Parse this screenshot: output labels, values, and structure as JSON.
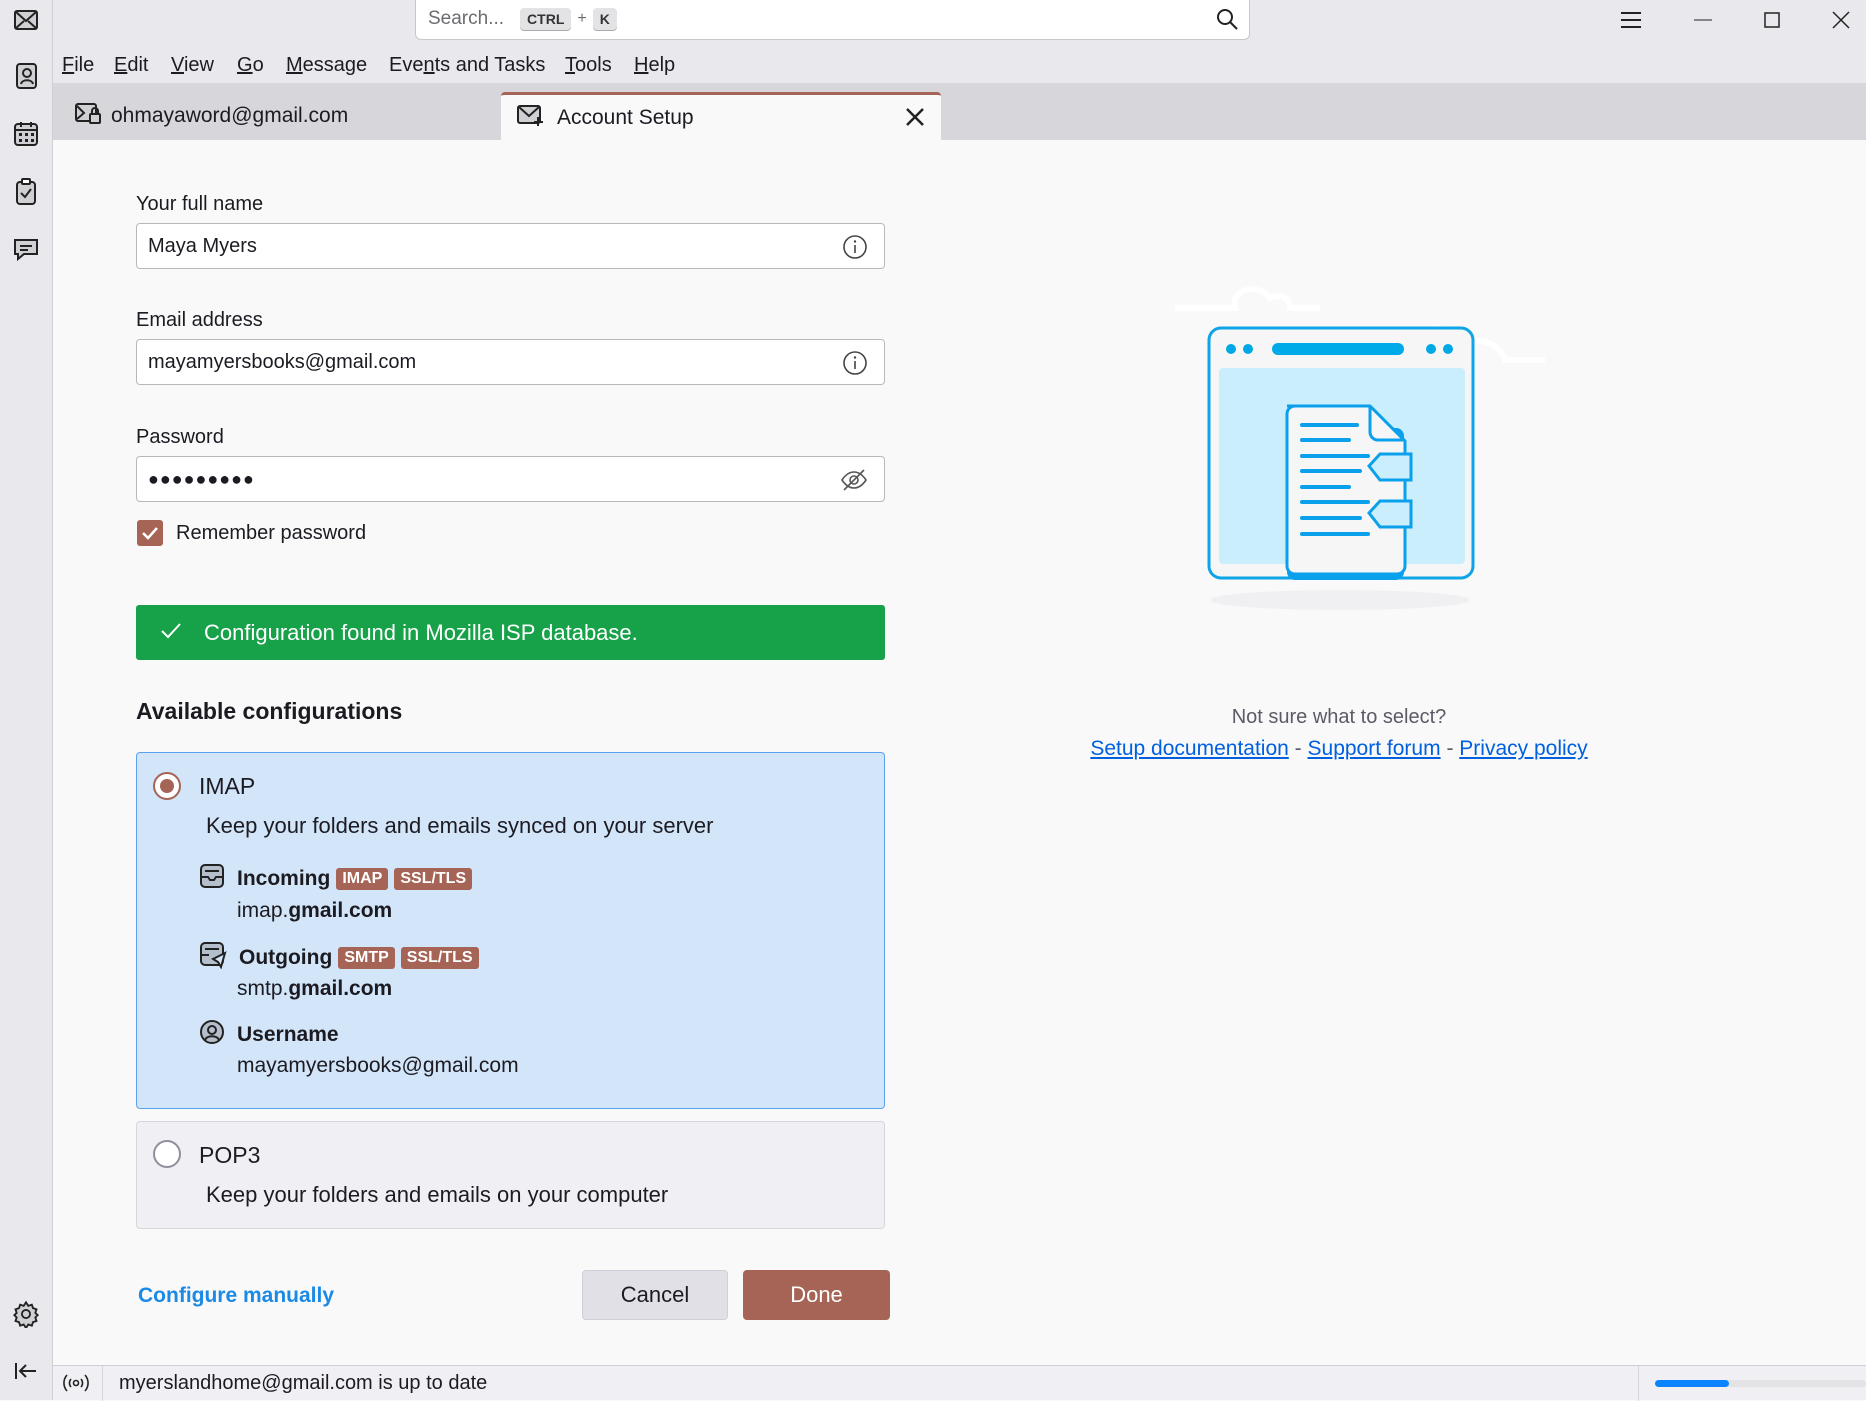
{
  "titlebar": {
    "search_placeholder": "Search...",
    "kbd_ctrl": "CTRL",
    "kbd_plus": "+",
    "kbd_k": "K"
  },
  "menu": [
    "File",
    "Edit",
    "View",
    "Go",
    "Message",
    "Events and Tasks",
    "Tools",
    "Help"
  ],
  "tabs": [
    {
      "label": "ohmayaword@gmail.com"
    },
    {
      "label": "Account Setup"
    }
  ],
  "form": {
    "name_label": "Your full name",
    "name_value": "Maya Myers",
    "email_label": "Email address",
    "email_value": "mayamyersbooks@gmail.com",
    "password_label": "Password",
    "password_value": "●●●●●●●●●",
    "remember_label": "Remember password",
    "remember_checked": true
  },
  "banner": "Configuration found in Mozilla ISP database.",
  "configs_title": "Available configurations",
  "imap": {
    "title": "IMAP",
    "desc": "Keep your folders and emails synced on your server",
    "incoming_label": "Incoming",
    "incoming_badges": [
      "IMAP",
      "SSL/TLS"
    ],
    "incoming_host_prefix": "imap.",
    "incoming_host_domain": "gmail.com",
    "outgoing_label": "Outgoing",
    "outgoing_badges": [
      "SMTP",
      "SSL/TLS"
    ],
    "outgoing_host_prefix": "smtp.",
    "outgoing_host_domain": "gmail.com",
    "username_label": "Username",
    "username_value": "mayamyersbooks@gmail.com"
  },
  "pop3": {
    "title": "POP3",
    "desc": "Keep your folders and emails on your computer"
  },
  "actions": {
    "configure_manually": "Configure manually",
    "cancel": "Cancel",
    "done": "Done"
  },
  "help": {
    "question": "Not sure what to select?",
    "links": [
      "Setup documentation",
      "Support forum",
      "Privacy policy"
    ],
    "sep": "-"
  },
  "status": {
    "text": "myerslandhome@gmail.com is up to date",
    "progress": 0.35
  },
  "colors": {
    "accent": "#a56456",
    "success": "#17a24a",
    "link": "#0060df",
    "selected_bg": "#d3e5f9"
  }
}
